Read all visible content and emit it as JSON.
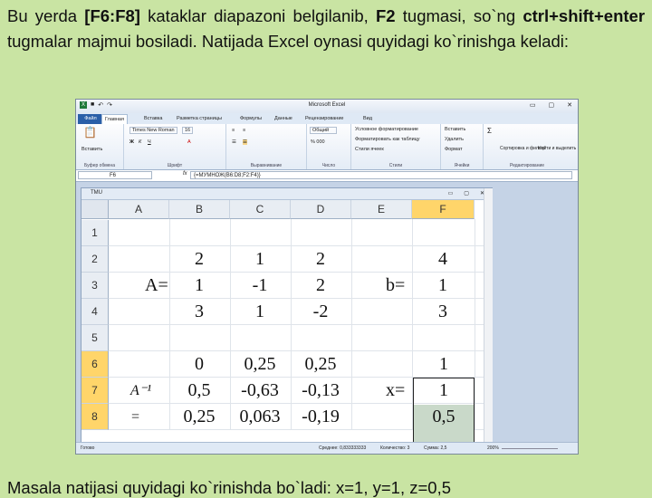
{
  "paragraph": {
    "s1": "Bu yerda ",
    "b1": "[F6:F8]",
    "s2": " kataklar diapazoni belgilanib, ",
    "b2": "F2",
    "s3": " tugmasi, so`ng ",
    "b3": "ctrl+shift+enter",
    "s4": " tugmalar majmui bosiladi. Natijada Excel oynasi quyidagi ko`rinishga keladi:"
  },
  "bottom_text": "Masala natijasi quyidagi ko`rinishda bo`ladi: x=1, y=1, z=0,5",
  "excel": {
    "title": "Microsoft Excel",
    "tabs": [
      "Файл",
      "Главная",
      "Вставка",
      "Разметка страницы",
      "Формулы",
      "Данные",
      "Рецензирование",
      "Вид"
    ],
    "ribbon": {
      "paste": "Вставить",
      "font_name": "Times New Roman",
      "font_size": "16",
      "bold": "Ж",
      "italic": "К",
      "underline": "Ч",
      "number_format": "Общий",
      "cond_format": "Условное форматирование",
      "format_table": "Форматировать как таблицу",
      "cell_styles": "Стили ячеек",
      "insert": "Вставить",
      "delete": "Удалить",
      "format": "Формат",
      "sort": "Сортировка и фильтр",
      "find": "Найти и выделить",
      "groups": [
        "Буфер обмена",
        "Шрифт",
        "Выравнивание",
        "Число",
        "Стили",
        "Ячейки",
        "Редактирование"
      ]
    },
    "name_box": "F6",
    "fx": "fx",
    "formula": "{=МУМНОЖ(B6:D8;F2:F4)}",
    "workbook_name": "TMU",
    "columns": [
      "A",
      "B",
      "C",
      "D",
      "E",
      "F"
    ],
    "rows": [
      "1",
      "2",
      "3",
      "4",
      "5",
      "6",
      "7",
      "8"
    ],
    "matrix_a": [
      [
        "2",
        "1",
        "2"
      ],
      [
        "1",
        "-1",
        "2"
      ],
      [
        "3",
        "1",
        "-2"
      ]
    ],
    "vector_b": [
      "4",
      "1",
      "3"
    ],
    "inverse": [
      [
        "0",
        "0,25",
        "0,25"
      ],
      [
        "0,5",
        "-0,63",
        "-0,13"
      ],
      [
        "0,25",
        "0,063",
        "-0,19"
      ]
    ],
    "result": [
      "1",
      "1",
      "0,5"
    ],
    "label_a": "A=",
    "label_b": "b=",
    "label_inv": "A⁻¹ =",
    "label_x": "x=",
    "status": {
      "ready": "Готово",
      "average": "Среднее: 0,833333333",
      "count": "Количество: 3",
      "sum": "Сумма: 2,5",
      "zoom": "200%"
    }
  }
}
